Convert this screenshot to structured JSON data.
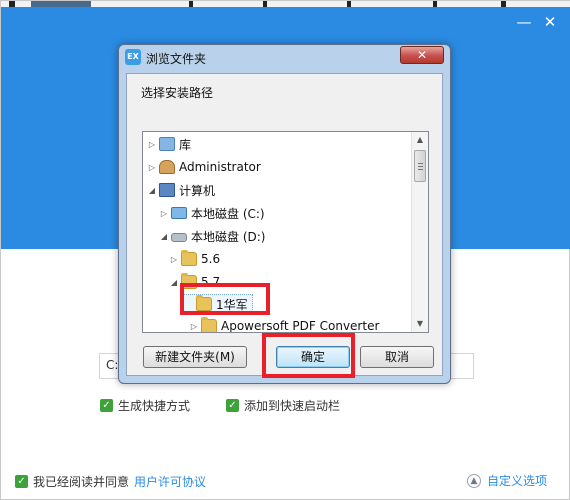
{
  "installer": {
    "path_value": "C:",
    "checkboxes": [
      {
        "label": "生成快捷方式",
        "checked": true
      },
      {
        "label": "添加到快速启动栏",
        "checked": true
      }
    ],
    "agree_prefix": "我已经阅读并同意",
    "agree_link": "用户许可协议",
    "custom_option": "自定义选项",
    "minimize_glyph": "—",
    "close_glyph": "✕"
  },
  "dialog": {
    "title": "浏览文件夹",
    "icon_text": "EX",
    "close_glyph": "✕",
    "prompt": "选择安装路径",
    "tree": [
      {
        "label": "库",
        "icon": "library-icon",
        "expander": "▷",
        "level": 0
      },
      {
        "label": "Administrator",
        "icon": "user-folder-icon",
        "expander": "▷",
        "level": 0
      },
      {
        "label": "计算机",
        "icon": "computer-icon",
        "expander": "◢",
        "level": 0
      },
      {
        "label": "本地磁盘 (C:)",
        "icon": "drive-icon",
        "expander": "▷",
        "level": 1
      },
      {
        "label": "本地磁盘 (D:)",
        "icon": "drive-icon",
        "expander": "◢",
        "level": 1
      },
      {
        "label": "5.6",
        "icon": "folder-icon",
        "expander": "▷",
        "level": 2
      },
      {
        "label": "5.7",
        "icon": "folder-icon",
        "expander": "◢",
        "level": 2
      },
      {
        "label": "1华军",
        "icon": "folder-icon",
        "expander": "",
        "level": 3
      },
      {
        "label": "Apowersoft PDF Converter",
        "icon": "folder-icon",
        "expander": "▷",
        "level": 3
      }
    ],
    "buttons": {
      "new_folder": "新建文件夹(M)",
      "ok": "确定",
      "cancel": "取消"
    }
  },
  "colors": {
    "header_blue": "#2b8be3",
    "highlight_red": "#e8202a",
    "check_green": "#3ea23a"
  }
}
